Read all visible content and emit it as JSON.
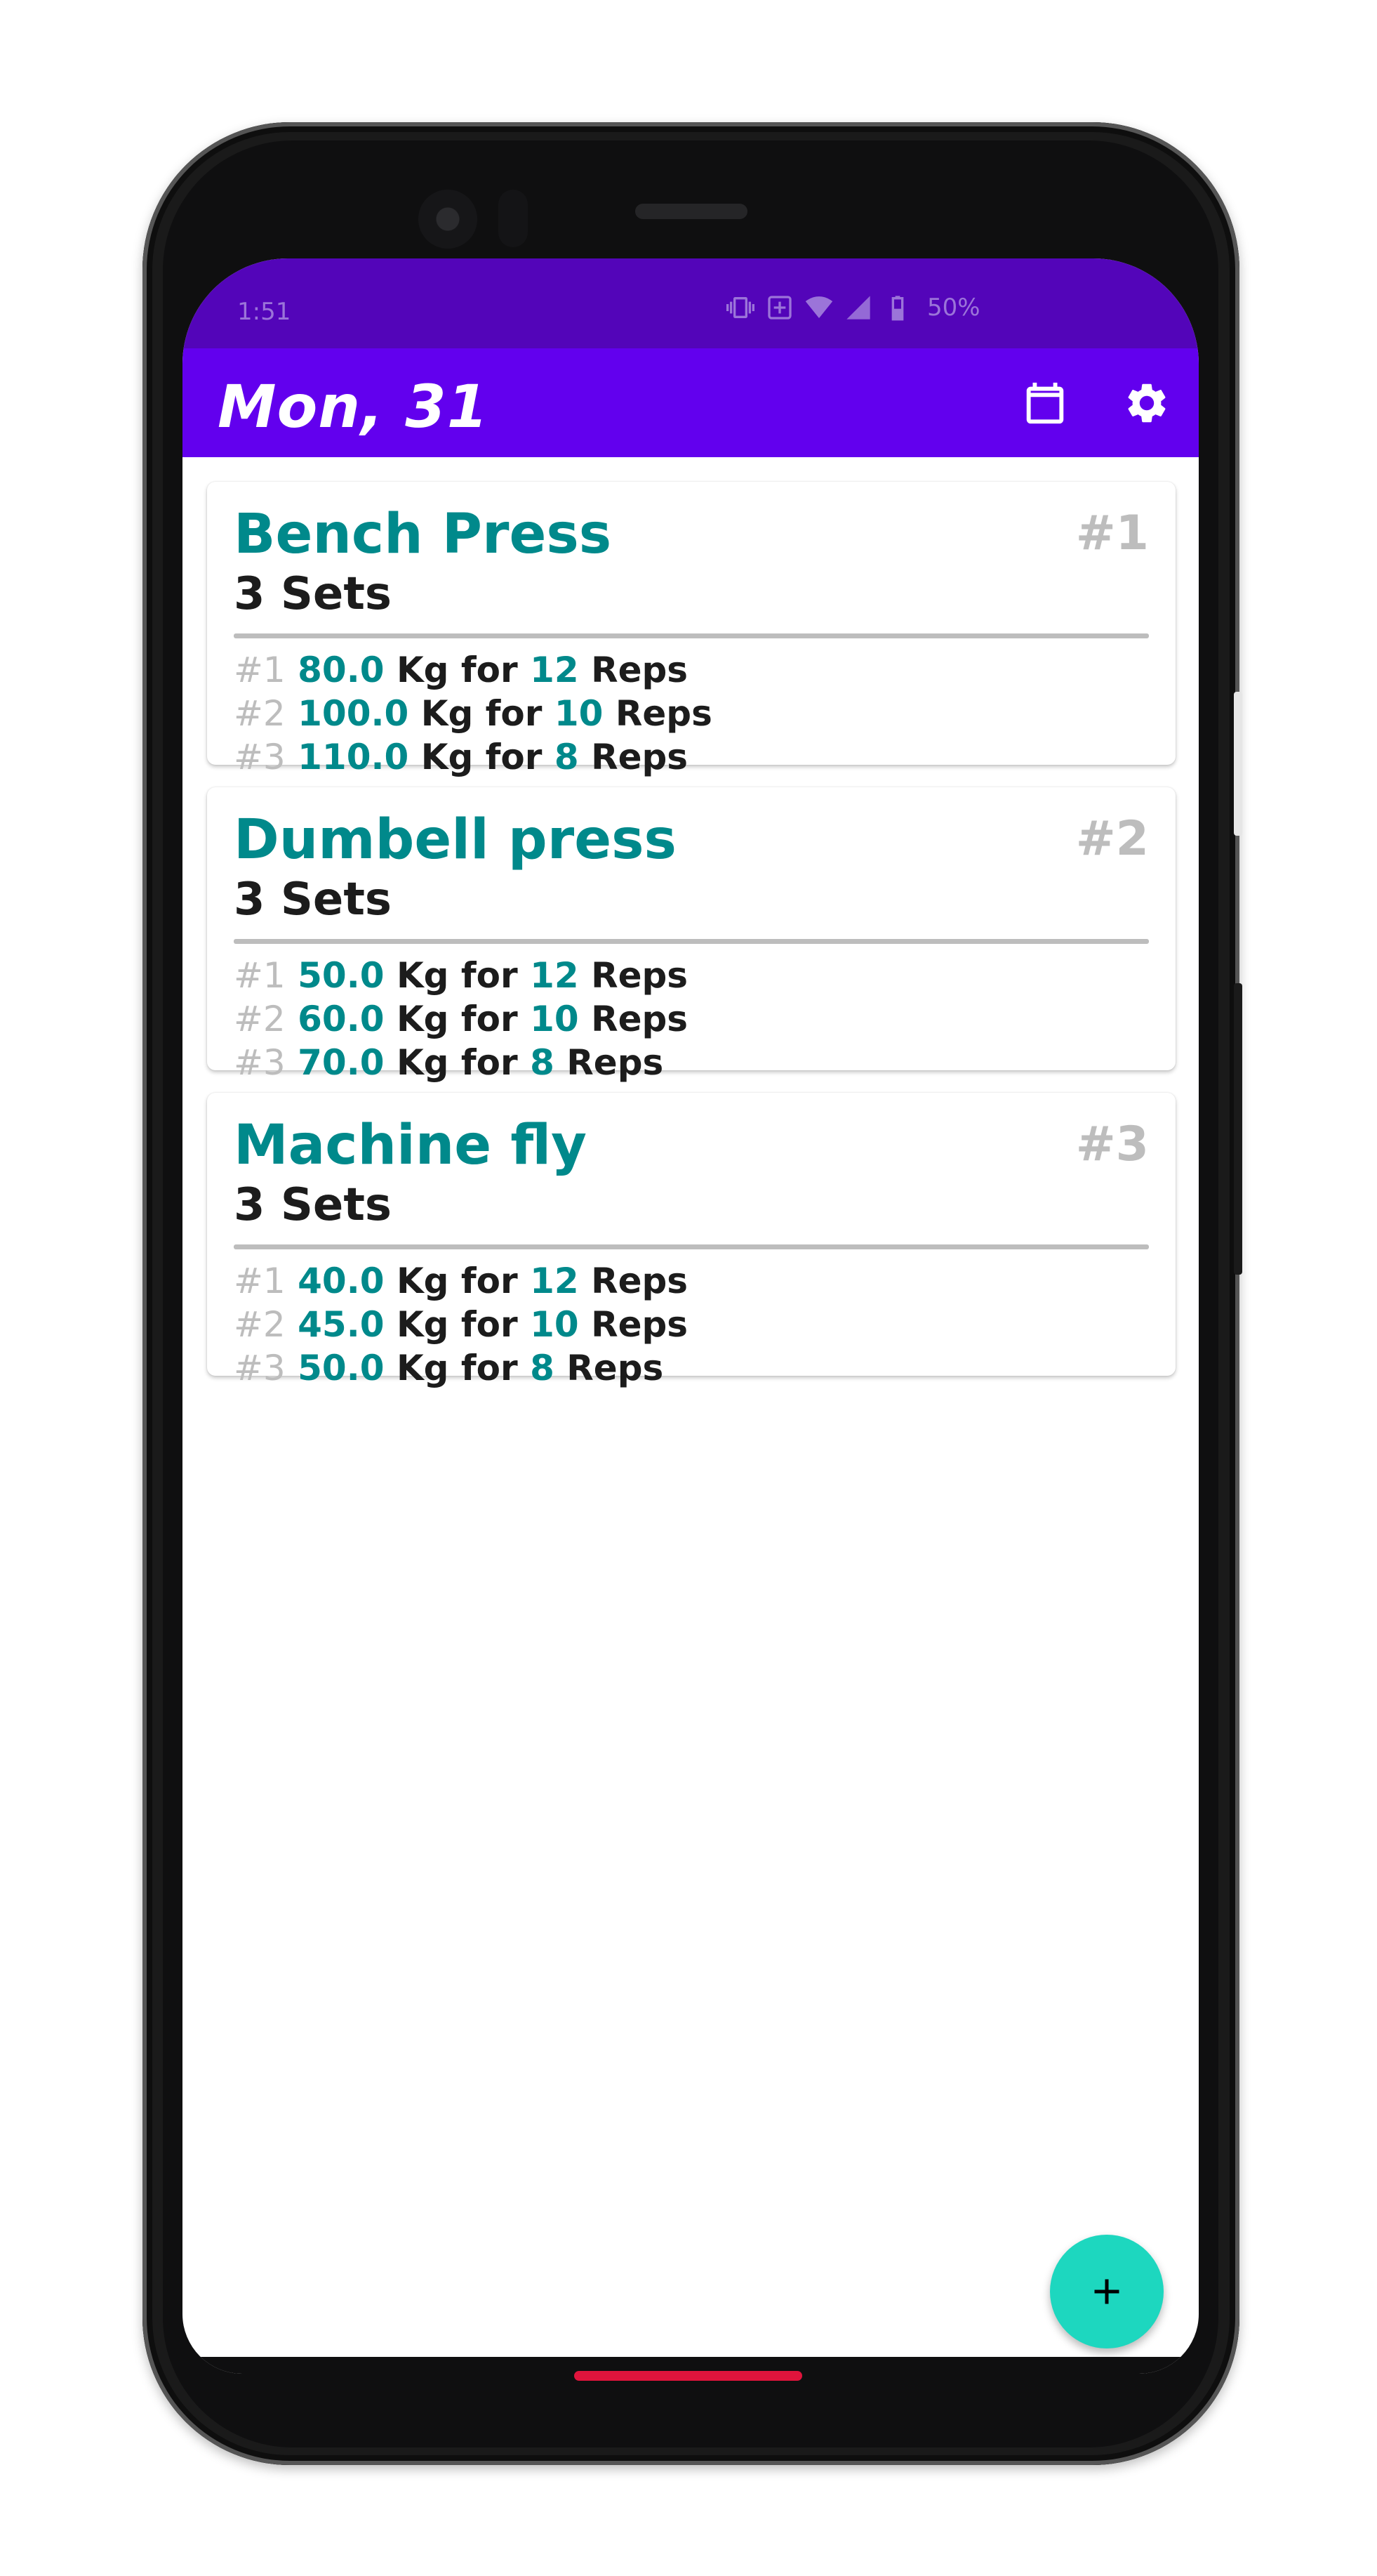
{
  "status_bar": {
    "time": "1:51",
    "icons": [
      "vibrate-icon",
      "data-saver-icon",
      "wifi-icon",
      "signal-icon",
      "battery-icon"
    ],
    "battery": "50%"
  },
  "app_bar": {
    "title": "Mon, 31",
    "actions": [
      "calendar-icon",
      "settings-icon"
    ],
    "color": "#6200ee"
  },
  "exercises": [
    {
      "name": "Bench Press",
      "index": "#1",
      "sets_label": "3 Sets",
      "sets": [
        {
          "num": "#1",
          "weight": "80.0",
          "unit": "Kg for",
          "reps": "12",
          "reps_label": "Reps"
        },
        {
          "num": "#2",
          "weight": "100.0",
          "unit": "Kg for",
          "reps": "10",
          "reps_label": "Reps"
        },
        {
          "num": "#3",
          "weight": "110.0",
          "unit": "Kg for",
          "reps": "8",
          "reps_label": "Reps"
        }
      ]
    },
    {
      "name": "Dumbell press",
      "index": "#2",
      "sets_label": "3 Sets",
      "sets": [
        {
          "num": "#1",
          "weight": "50.0",
          "unit": "Kg for",
          "reps": "12",
          "reps_label": "Reps"
        },
        {
          "num": "#2",
          "weight": "60.0",
          "unit": "Kg for",
          "reps": "10",
          "reps_label": "Reps"
        },
        {
          "num": "#3",
          "weight": "70.0",
          "unit": "Kg for",
          "reps": "8",
          "reps_label": "Reps"
        }
      ]
    },
    {
      "name": "Machine fly",
      "index": "#3",
      "sets_label": "3 Sets",
      "sets": [
        {
          "num": "#1",
          "weight": "40.0",
          "unit": "Kg for",
          "reps": "12",
          "reps_label": "Reps"
        },
        {
          "num": "#2",
          "weight": "45.0",
          "unit": "Kg for",
          "reps": "10",
          "reps_label": "Reps"
        },
        {
          "num": "#3",
          "weight": "50.0",
          "unit": "Kg for",
          "reps": "8",
          "reps_label": "Reps"
        }
      ]
    }
  ],
  "fab": {
    "icon": "plus-icon",
    "color": "#1dd7bf"
  },
  "colors": {
    "accent": "#00898b",
    "muted": "#bdbdbd",
    "statusbar": "#5305b9"
  }
}
